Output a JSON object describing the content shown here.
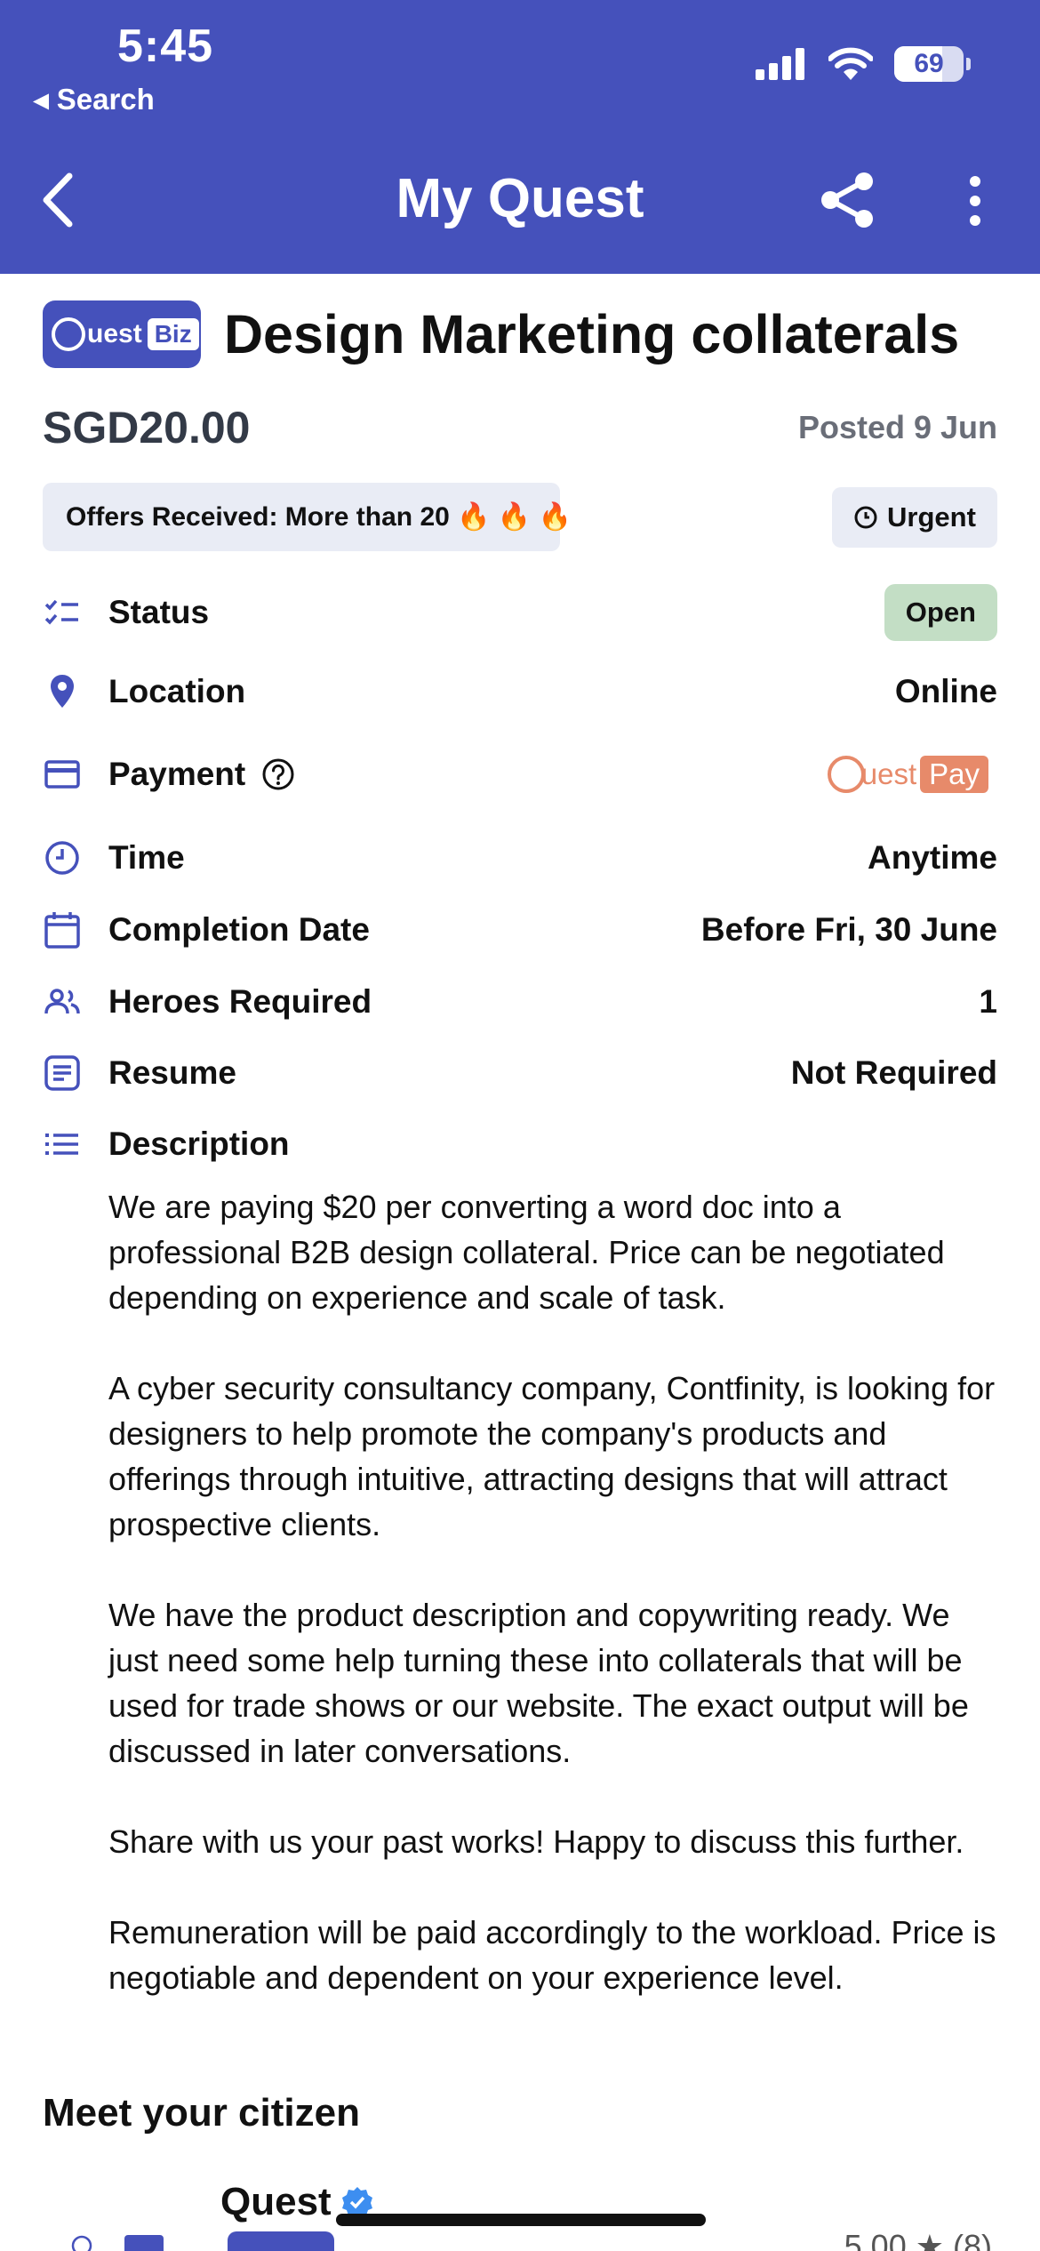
{
  "status_bar": {
    "time": "5:45",
    "back_label": "◂ Search",
    "battery": "69",
    "battery_level": 0.69
  },
  "nav": {
    "title": "My Quest"
  },
  "logo": {
    "quest": "uest",
    "biz": "Biz"
  },
  "job": {
    "title": "Design Marketing collaterals",
    "price": "SGD20.00",
    "posted": "Posted 9 Jun",
    "offers": "Offers Received: More than 20 🔥 🔥 🔥",
    "urgent": "Urgent"
  },
  "details": {
    "status": {
      "label": "Status",
      "value": "Open"
    },
    "location": {
      "label": "Location",
      "value": "Online"
    },
    "payment": {
      "label": "Payment",
      "pay_quest": "uest",
      "pay_pay": "Pay"
    },
    "time": {
      "label": "Time",
      "value": "Anytime"
    },
    "completion": {
      "label": "Completion Date",
      "value": "Before Fri, 30 June"
    },
    "heroes": {
      "label": "Heroes Required",
      "value": "1"
    },
    "resume": {
      "label": "Resume",
      "value": "Not Required"
    },
    "description": {
      "label": "Description"
    }
  },
  "description_paragraphs": [
    "We are paying $20 per converting a word doc into a professional B2B design collateral. Price can be negotiated depending on experience and scale of task.",
    "A cyber security consultancy company, Contfinity, is looking for designers to help promote the company's products and offerings through intuitive, attracting designs that will attract prospective clients.",
    "We have the product description and copywriting ready. We just need some help turning these into collaterals that will be used for trade shows or our website. The exact output will be discussed in later conversations.",
    "Share with us your past works! Happy to discuss this further.",
    "Remuneration will be paid accordingly to the workload. Price is negotiable and dependent on your experience level."
  ],
  "citizen": {
    "heading": "Meet your citizen",
    "name": "Quest",
    "rating": "5.00 ★ (8)"
  },
  "colors": {
    "brand": "#4551bb",
    "open_badge": "#c3dec5",
    "questpay": "#e78a6a"
  }
}
